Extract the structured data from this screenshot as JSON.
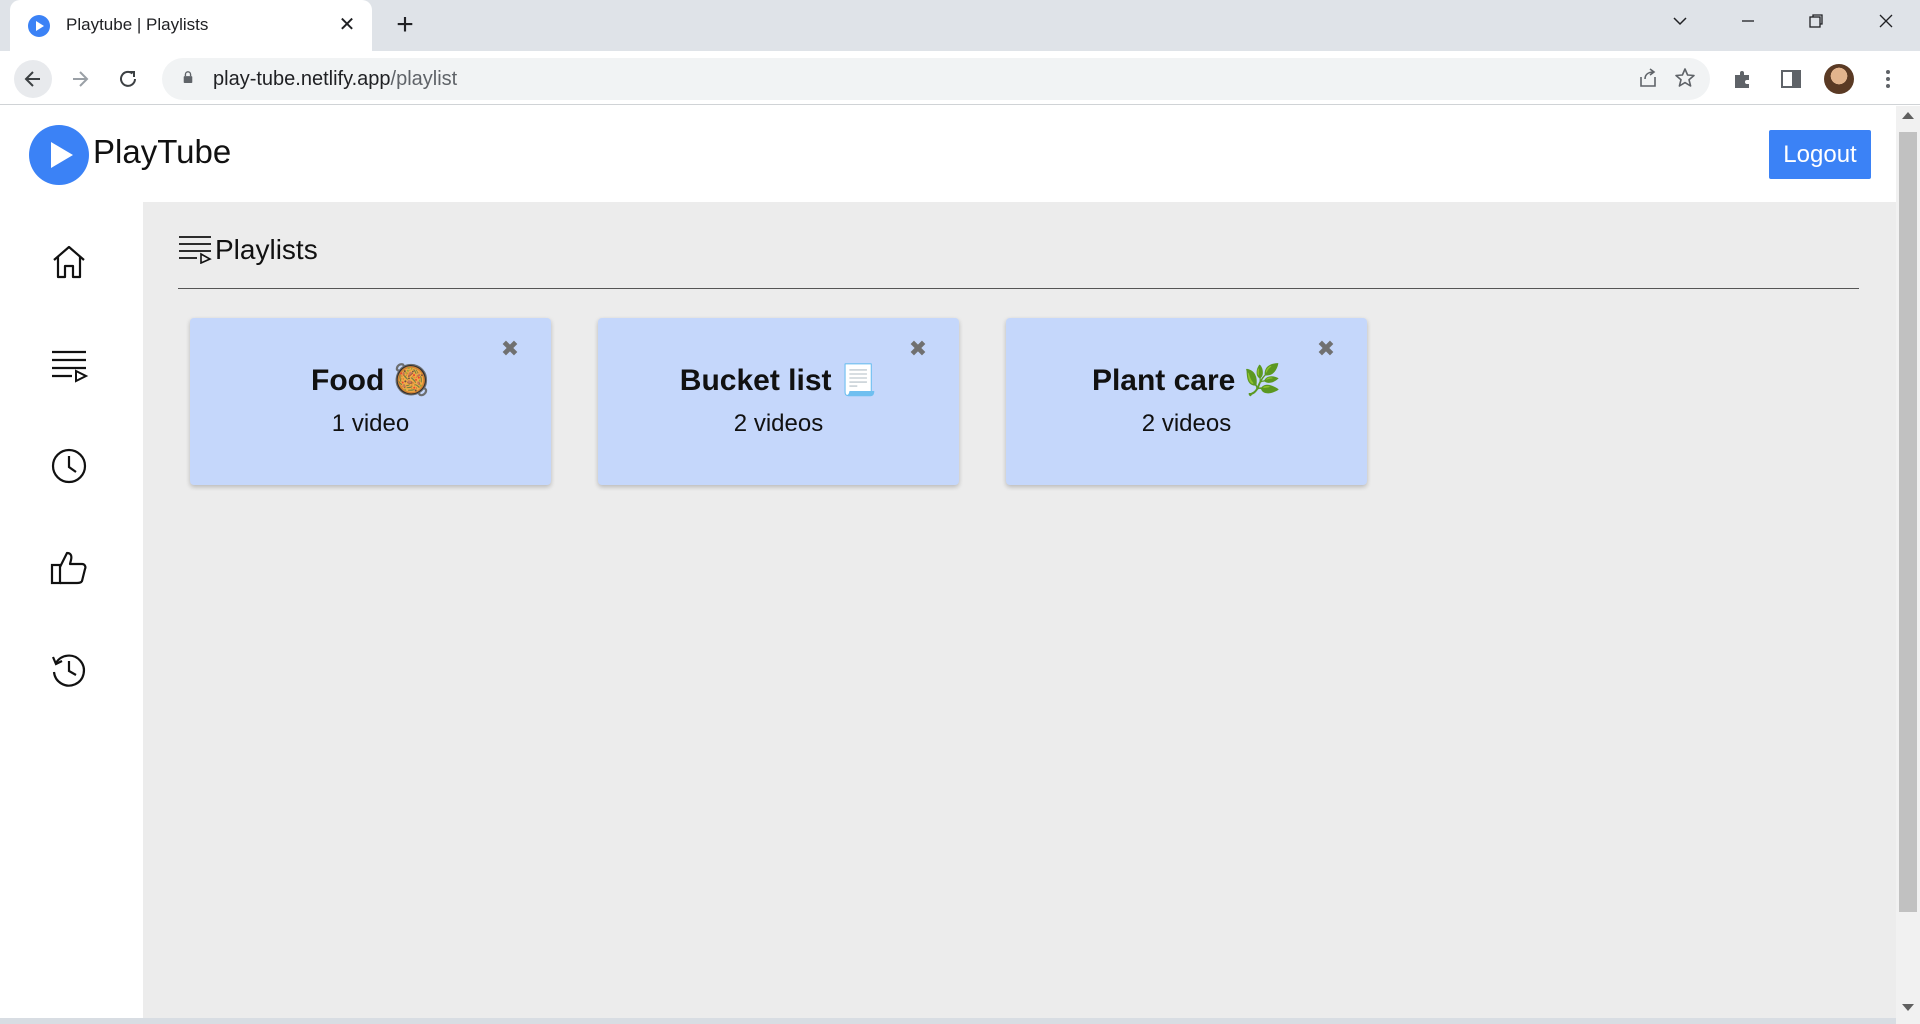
{
  "browser": {
    "tab_title": "Playtube | Playlists",
    "tab_close": "✕",
    "new_tab": "+",
    "url_host": "play-tube.netlify.app",
    "url_path": "/playlist",
    "controls": {
      "minimize": "—",
      "restore": "❐",
      "close": "✕",
      "tab_search": "⌄"
    }
  },
  "header": {
    "brand": "PlayTube",
    "logout_label": "Logout",
    "accent": "#3b82f6"
  },
  "sidebar": {
    "items": [
      {
        "name": "home",
        "icon": "home-icon"
      },
      {
        "name": "playlists",
        "icon": "playlist-icon"
      },
      {
        "name": "watch-later",
        "icon": "clock-icon"
      },
      {
        "name": "liked",
        "icon": "thumbs-up-icon"
      },
      {
        "name": "history",
        "icon": "history-icon"
      }
    ]
  },
  "main": {
    "section_title": "Playlists",
    "playlists": [
      {
        "title": "Food 🥘",
        "count": "1 video",
        "close": "✖"
      },
      {
        "title": "Bucket list 📃",
        "count": "2 videos",
        "close": "✖"
      },
      {
        "title": "Plant care 🌿",
        "count": "2 videos",
        "close": "✖"
      }
    ],
    "card_color": "#c5d7fb"
  }
}
